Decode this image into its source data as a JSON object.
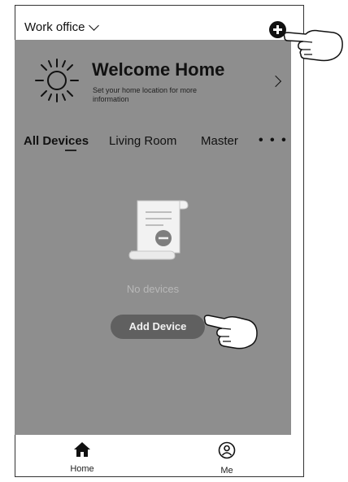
{
  "header": {
    "location_label": "Work office",
    "add_icon": "plus-circle-icon"
  },
  "welcome": {
    "title": "Welcome Home",
    "subtitle": "Set your home location for more information",
    "icon": "sun-icon",
    "arrow_icon": "chevron-right-icon"
  },
  "tabs": [
    {
      "label": "All Devices",
      "active": true
    },
    {
      "label": "Living Room",
      "active": false
    },
    {
      "label": "Master",
      "active": false
    }
  ],
  "tabs_more_label": "• • •",
  "empty_state": {
    "icon": "document-icon",
    "message": "No devices",
    "button_label": "Add Device"
  },
  "bottom_nav": [
    {
      "label": "Home",
      "icon": "home-icon"
    },
    {
      "label": "Me",
      "icon": "person-icon"
    }
  ],
  "colors": {
    "content_background": "#8e8e8e",
    "button_background": "#606060",
    "muted_text": "#b8b8b8"
  }
}
